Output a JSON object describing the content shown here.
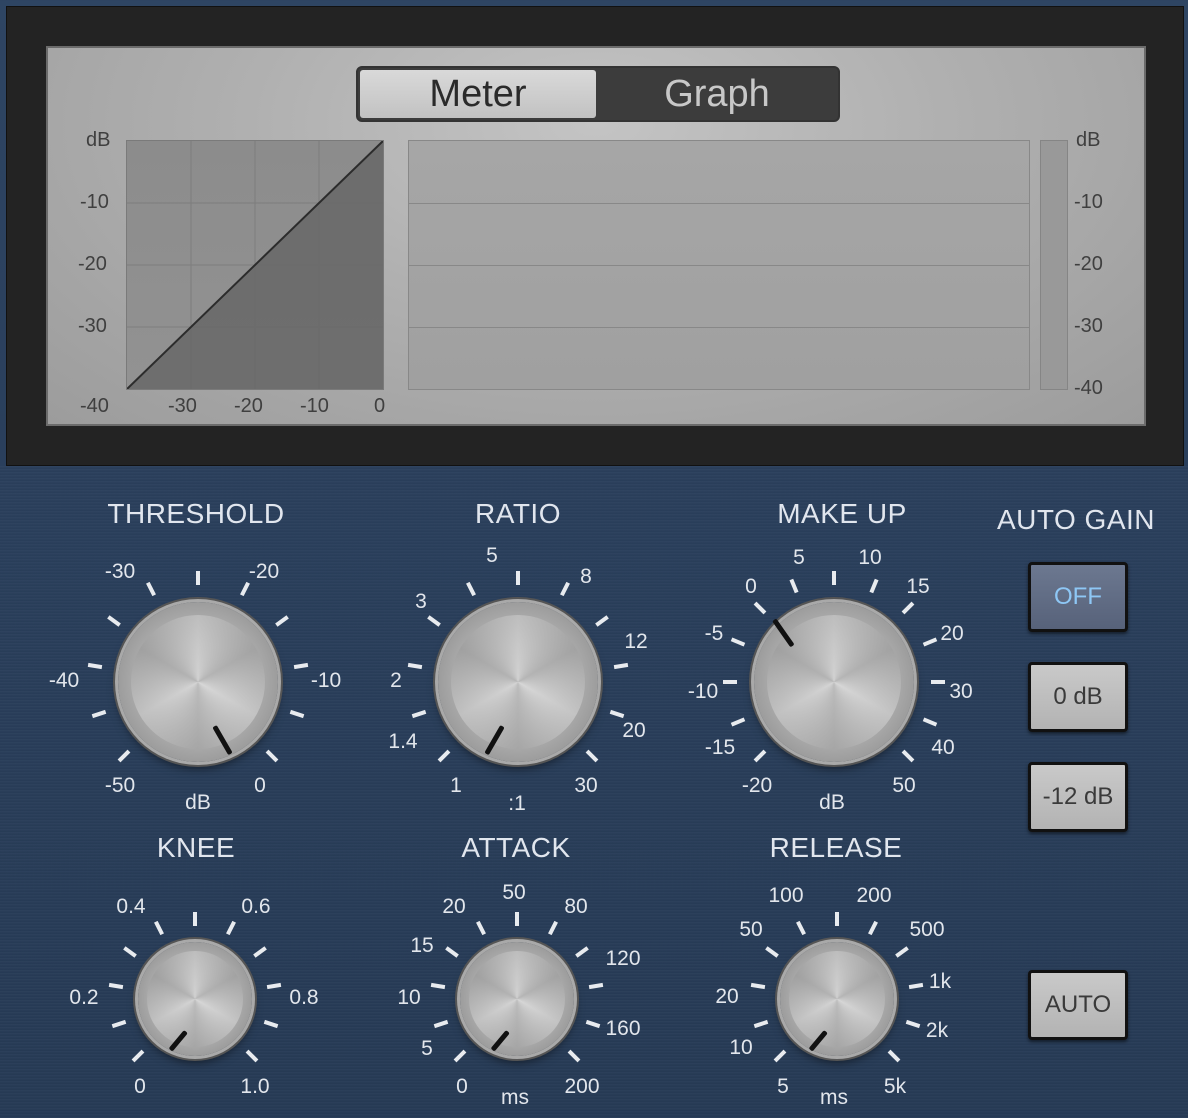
{
  "display": {
    "tabs": {
      "meter": "Meter",
      "graph": "Graph"
    },
    "curve": {
      "y_unit": "dB",
      "y_labels": [
        "-10",
        "-20",
        "-30",
        "-40"
      ],
      "x_labels": [
        "-30",
        "-20",
        "-10",
        "0"
      ]
    },
    "meter": {
      "unit": "dB",
      "labels": [
        "-10",
        "-20",
        "-30",
        "-40"
      ]
    }
  },
  "knobs": {
    "threshold": {
      "title": "THRESHOLD",
      "unit": "dB",
      "labels": [
        "-30",
        "-20",
        "-40",
        "-10",
        "-50",
        "0"
      ]
    },
    "ratio": {
      "title": "RATIO",
      "unit": ":1",
      "labels": [
        "5",
        "8",
        "3",
        "12",
        "2",
        "20",
        "1.4",
        "30",
        "1"
      ]
    },
    "makeup": {
      "title": "MAKE UP",
      "unit": "dB",
      "labels": [
        "5",
        "10",
        "0",
        "15",
        "-5",
        "20",
        "-10",
        "30",
        "-15",
        "40",
        "-20",
        "50"
      ]
    },
    "knee": {
      "title": "KNEE",
      "labels": [
        "0.4",
        "0.6",
        "0.2",
        "0.8",
        "0",
        "1.0"
      ]
    },
    "attack": {
      "title": "ATTACK",
      "unit": "ms",
      "labels": [
        "50",
        "20",
        "80",
        "15",
        "120",
        "10",
        "160",
        "5",
        "0",
        "200"
      ]
    },
    "release": {
      "title": "RELEASE",
      "unit": "ms",
      "labels": [
        "100",
        "200",
        "50",
        "500",
        "20",
        "1k",
        "10",
        "2k",
        "5",
        "5k"
      ]
    }
  },
  "auto_gain": {
    "title": "AUTO GAIN",
    "off_label": "OFF",
    "zero_db_label": "0 dB",
    "minus12_label": "-12 dB",
    "auto_label": "AUTO"
  }
}
